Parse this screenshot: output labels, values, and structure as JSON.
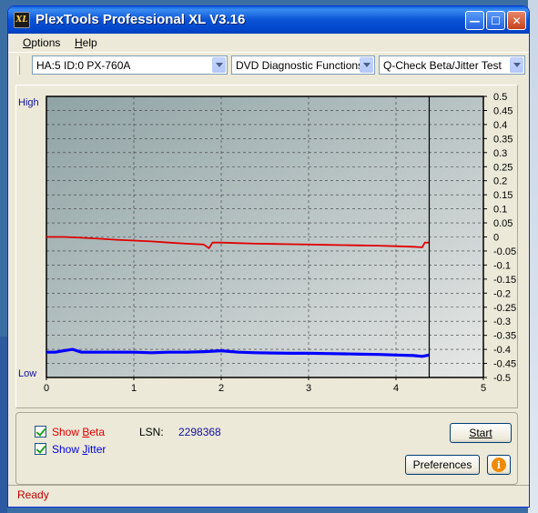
{
  "window": {
    "title": "PlexTools Professional XL V3.16",
    "icon_label": "XL",
    "minimize_symbol": "—",
    "maximize_symbol": "☐",
    "close_symbol": "✕"
  },
  "menu": {
    "options": "Options",
    "help": "Help"
  },
  "toolbar": {
    "drive": "HA:5 ID:0  PX-760A",
    "function": "DVD Diagnostic Functions",
    "test": "Q-Check Beta/Jitter Test"
  },
  "chart_data": {
    "type": "line",
    "y_left_top": "High",
    "y_left_bottom": "Low",
    "x_ticks": [
      0,
      1,
      2,
      3,
      4,
      5
    ],
    "y_ticks": [
      0.5,
      0.45,
      0.4,
      0.35,
      0.3,
      0.25,
      0.2,
      0.15,
      0.1,
      0.05,
      0,
      -0.05,
      -0.1,
      -0.15,
      -0.2,
      -0.25,
      -0.3,
      -0.35,
      -0.4,
      -0.45,
      -0.5
    ],
    "y_tick_labels": [
      "0.5",
      "0.45",
      "0.4",
      "0.35",
      "0.3",
      "0.25",
      "0.2",
      "0.15",
      "0.1",
      "0.05",
      "0",
      "-0.05",
      "-0.1",
      "-0.15",
      "-0.2",
      "-0.25",
      "-0.3",
      "-0.35",
      "-0.4",
      "-0.45",
      "-0.5"
    ],
    "xlim": [
      0,
      5
    ],
    "ylim": [
      -0.5,
      0.5
    ],
    "end_marker_x": 4.38,
    "grid": true,
    "colors": {
      "beta": "#e00000",
      "jitter": "#0000ff",
      "accent": "#1010a0"
    },
    "series": [
      {
        "name": "Beta",
        "x": [
          0,
          0.2,
          0.4,
          0.6,
          0.8,
          1.0,
          1.2,
          1.4,
          1.6,
          1.8,
          1.86,
          1.9,
          2.0,
          2.2,
          2.4,
          2.6,
          2.8,
          3.0,
          3.2,
          3.4,
          3.6,
          3.8,
          4.0,
          4.2,
          4.3,
          4.33,
          4.38
        ],
        "values": [
          0.0,
          0.0,
          -0.003,
          -0.006,
          -0.01,
          -0.013,
          -0.016,
          -0.02,
          -0.024,
          -0.027,
          -0.04,
          -0.02,
          -0.02,
          -0.022,
          -0.024,
          -0.025,
          -0.026,
          -0.027,
          -0.028,
          -0.029,
          -0.03,
          -0.031,
          -0.033,
          -0.035,
          -0.037,
          -0.02,
          -0.02
        ]
      },
      {
        "name": "Jitter",
        "x": [
          0,
          0.1,
          0.2,
          0.3,
          0.4,
          0.6,
          0.8,
          1.0,
          1.2,
          1.4,
          1.6,
          1.8,
          2.0,
          2.2,
          2.4,
          2.6,
          2.8,
          3.0,
          3.2,
          3.4,
          3.6,
          3.8,
          4.0,
          4.2,
          4.3,
          4.38
        ],
        "values": [
          -0.41,
          -0.41,
          -0.405,
          -0.4,
          -0.41,
          -0.41,
          -0.41,
          -0.41,
          -0.412,
          -0.41,
          -0.41,
          -0.408,
          -0.405,
          -0.41,
          -0.412,
          -0.413,
          -0.414,
          -0.414,
          -0.415,
          -0.416,
          -0.417,
          -0.418,
          -0.42,
          -0.422,
          -0.425,
          -0.42
        ]
      }
    ]
  },
  "options": {
    "show_beta": {
      "label_main": "Show ",
      "label_accel": "B",
      "label_rest": "eta",
      "checked": true
    },
    "show_jitter": {
      "label_main": "Show ",
      "label_accel": "J",
      "label_rest": "itter",
      "checked": true
    },
    "lsn_label": "LSN:",
    "lsn_value": "2298368",
    "start_button": "Start",
    "preferences_button": "Preferences",
    "info_symbol": "i"
  },
  "status": {
    "text": "Ready"
  }
}
